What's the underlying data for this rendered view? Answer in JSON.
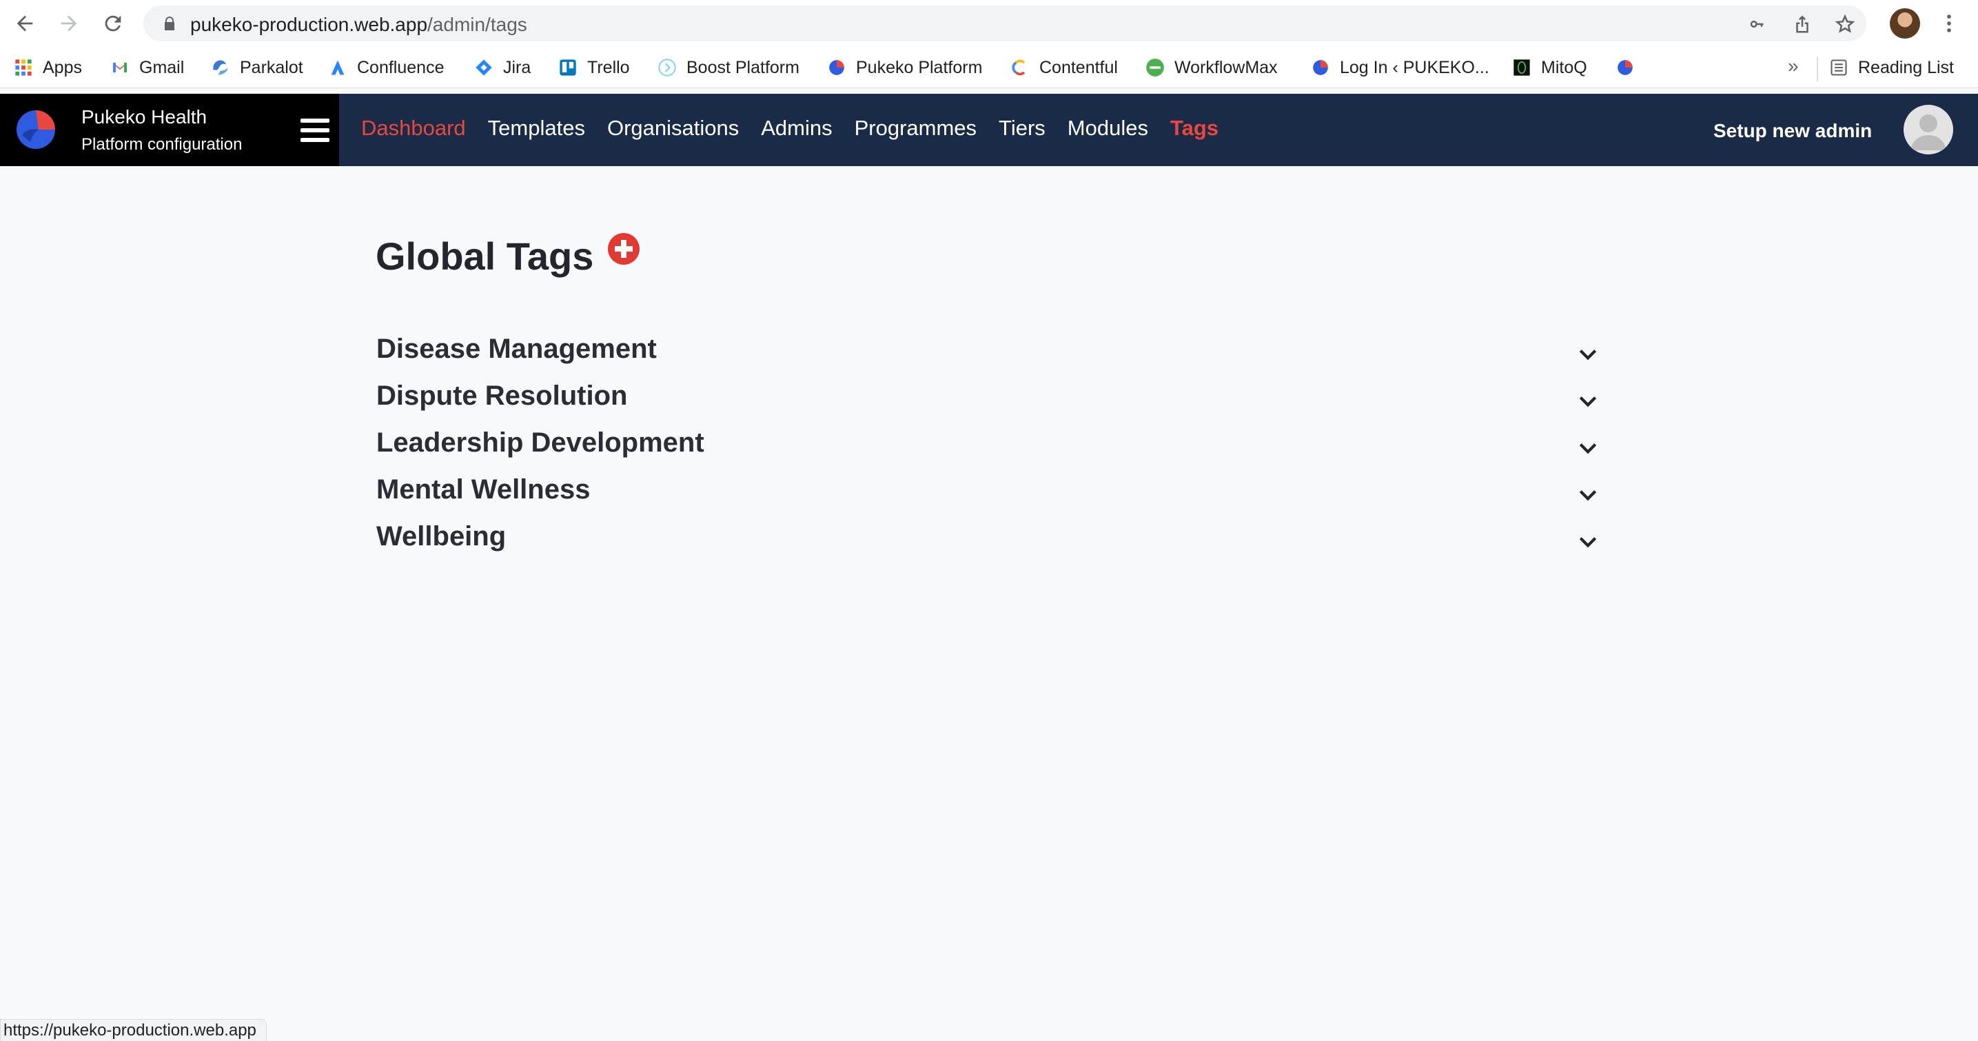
{
  "browser": {
    "url_host": "pukeko-production.web.app",
    "url_path": "/admin/tags",
    "bookmarks": [
      {
        "label": "Apps",
        "icon": "apps-grid-icon"
      },
      {
        "label": "Gmail",
        "icon": "gmail-icon"
      },
      {
        "label": "Parkalot",
        "icon": "parkalot-icon"
      },
      {
        "label": "Confluence",
        "icon": "confluence-icon"
      },
      {
        "label": "Jira",
        "icon": "jira-icon"
      },
      {
        "label": "Trello",
        "icon": "trello-icon"
      },
      {
        "label": "Boost Platform",
        "icon": "boost-icon"
      },
      {
        "label": "Pukeko Platform",
        "icon": "pukeko-icon"
      },
      {
        "label": "Contentful",
        "icon": "contentful-icon"
      },
      {
        "label": "WorkflowMax",
        "icon": "xero-icon"
      },
      {
        "label": "Log In ‹ PUKEKO...",
        "icon": "pukeko-icon"
      },
      {
        "label": "MitoQ",
        "icon": "mitoq-icon"
      }
    ],
    "overflow": "»",
    "reading_list": "Reading List",
    "status_url": "https://pukeko-production.web.app"
  },
  "app": {
    "brand_name": "Pukeko Health",
    "brand_sub": "Platform configuration",
    "nav": [
      {
        "label": "Dashboard",
        "state": "highlight"
      },
      {
        "label": "Templates",
        "state": "normal"
      },
      {
        "label": "Organisations",
        "state": "normal"
      },
      {
        "label": "Admins",
        "state": "normal"
      },
      {
        "label": "Programmes",
        "state": "normal"
      },
      {
        "label": "Tiers",
        "state": "normal"
      },
      {
        "label": "Modules",
        "state": "normal"
      },
      {
        "label": "Tags",
        "state": "current"
      }
    ],
    "setup_admin": "Setup new admin"
  },
  "main": {
    "title": "Global Tags",
    "tags": [
      {
        "label": "Disease Management"
      },
      {
        "label": "Dispute Resolution"
      },
      {
        "label": "Leadership Development"
      },
      {
        "label": "Mental Wellness"
      },
      {
        "label": "Wellbeing"
      }
    ]
  },
  "colors": {
    "header_bg": "#1a2b47",
    "accent": "#e8483f",
    "add_button": "#e03a33"
  }
}
